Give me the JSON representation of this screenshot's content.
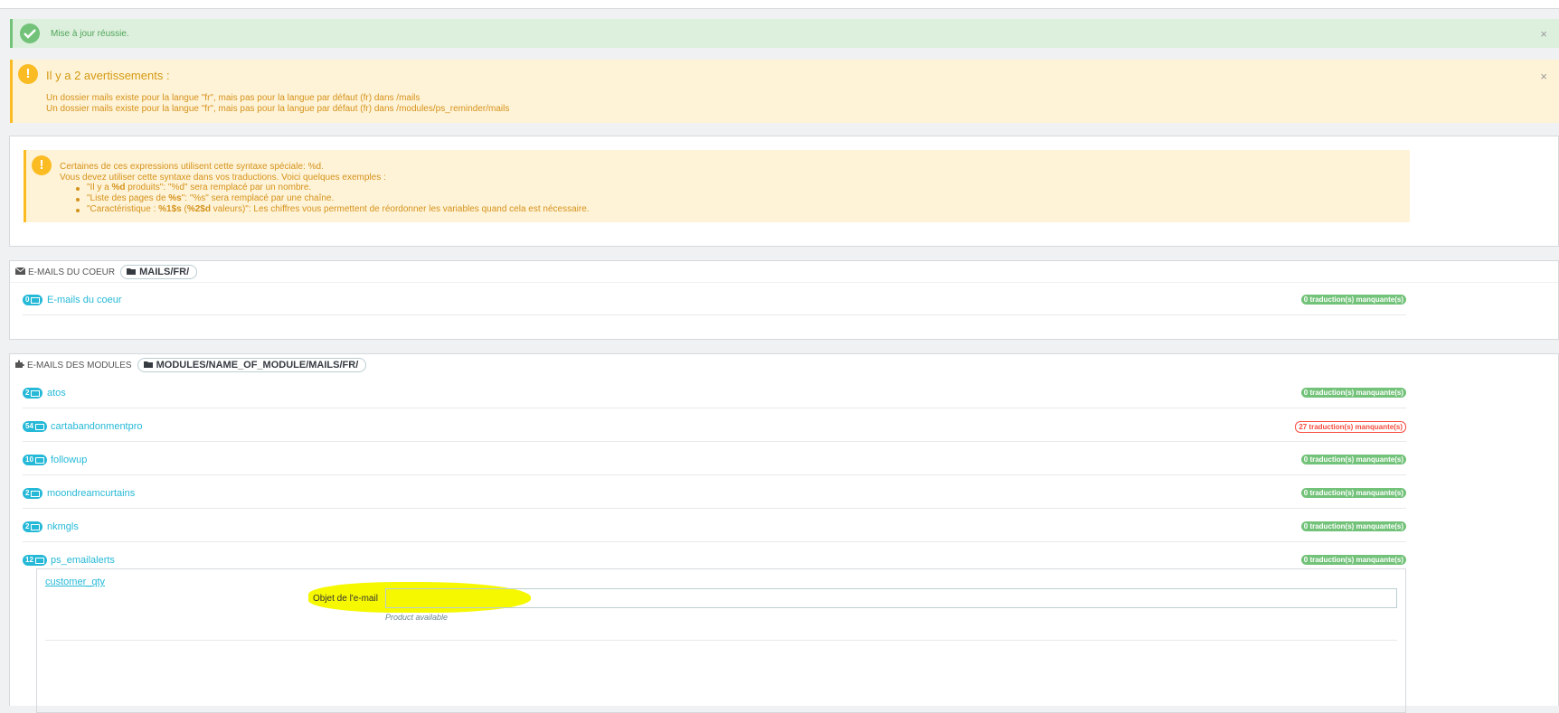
{
  "success_alert": {
    "message": "Mise à jour réussie.",
    "close": "×"
  },
  "warning_alert": {
    "icon": "!",
    "title": "Il y a 2 avertissements :",
    "lines": [
      "Un dossier mails existe pour la langue \"fr\", mais pas pour la langue par défaut (fr) dans /mails",
      "Un dossier mails existe pour la langue \"fr\", mais pas pour la langue par défaut (fr) dans /modules/ps_reminder/mails"
    ],
    "close": "×"
  },
  "syntax_info": {
    "icon": "!",
    "intro1": "Certaines de ces expressions utilisent cette syntaxe spéciale: %d.",
    "intro2": "Vous devez utiliser cette syntaxe dans vos traductions. Voici quelques exemples :",
    "ex1_a": "\"Il y a ",
    "ex1_b": "%d",
    "ex1_c": " produits\": \"%d\" sera remplacé par un nombre.",
    "ex2_a": "\"Liste des pages de ",
    "ex2_b": "%s",
    "ex2_c": "\": \"%s\" sera remplacé par une chaîne.",
    "ex3_a": "\"Caractéristique : ",
    "ex3_b": "%1$s",
    "ex3_c": " (",
    "ex3_d": "%2$d",
    "ex3_e": " valeurs)\": Les chiffres vous permettent de réordonner les variables quand cela est nécessaire."
  },
  "core_panel": {
    "heading": "E-mails du coeur",
    "folder": "MAILS/FR/",
    "rows": [
      {
        "count": "0",
        "name": "E-mails du coeur",
        "missing": "0 traduction(s) manquante(s)",
        "status": "ok"
      }
    ]
  },
  "modules_panel": {
    "heading": "E-mails des modules",
    "folder": "MODULES/NAME_OF_MODULE/MAILS/FR/",
    "rows": [
      {
        "count": "2",
        "name": "atos",
        "missing": "0 traduction(s) manquante(s)",
        "status": "ok"
      },
      {
        "count": "54",
        "name": "cartabandonmentpro",
        "missing": "27 traduction(s) manquante(s)",
        "status": "bad"
      },
      {
        "count": "10",
        "name": "followup",
        "missing": "0 traduction(s) manquante(s)",
        "status": "ok"
      },
      {
        "count": "2",
        "name": "moondreamcurtains",
        "missing": "0 traduction(s) manquante(s)",
        "status": "ok"
      },
      {
        "count": "2",
        "name": "nkmgls",
        "missing": "0 traduction(s) manquante(s)",
        "status": "ok"
      },
      {
        "count": "12",
        "name": "ps_emailalerts",
        "missing": "0 traduction(s) manquante(s)",
        "status": "ok"
      }
    ],
    "expanded": {
      "template_name": "customer_qty",
      "subject_label": "Objet de l'e-mail",
      "subject_value": "",
      "subject_help": "Product available"
    }
  },
  "colors": {
    "primary": "#25b9d7",
    "success": "#72c279",
    "warning": "#fbbb22",
    "danger": "#f54c3e",
    "highlight": "#f6f800"
  }
}
